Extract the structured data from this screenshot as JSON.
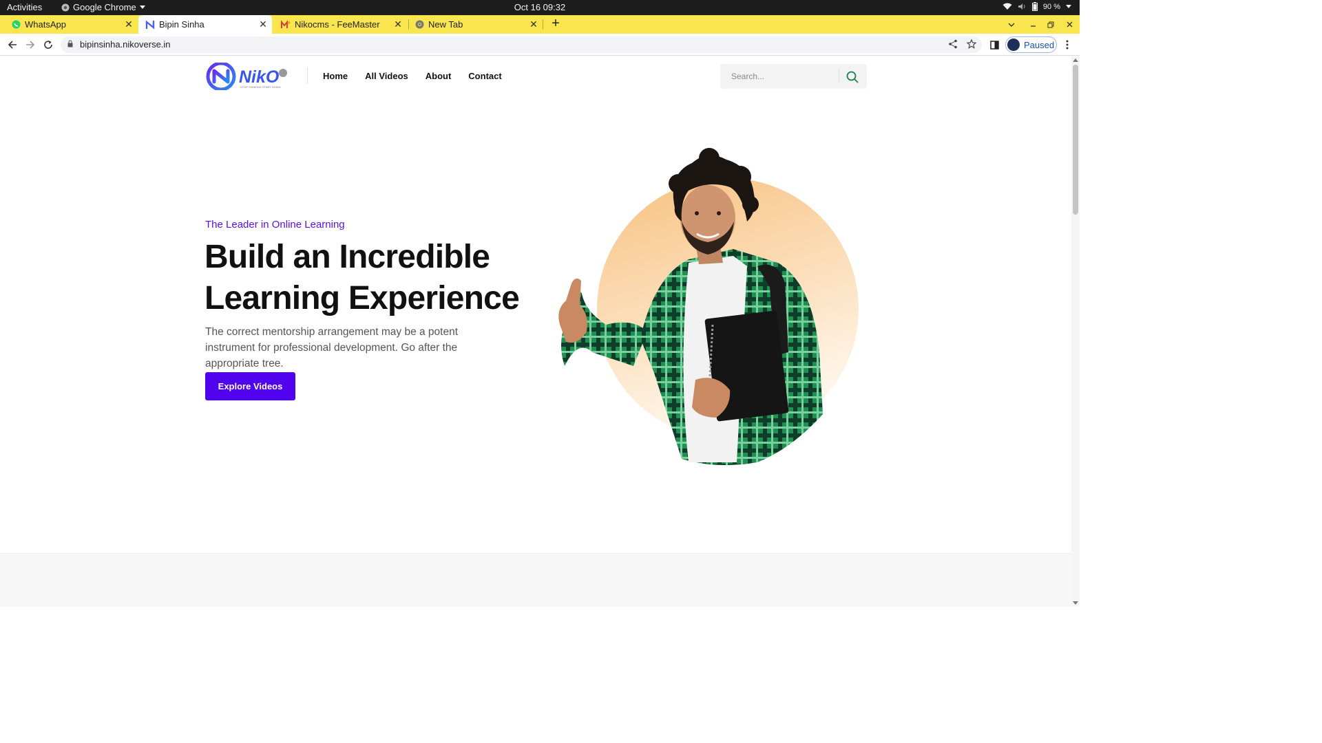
{
  "system": {
    "activities": "Activities",
    "app_name": "Google Chrome",
    "clock": "Oct 16  09:32",
    "battery": "90 %"
  },
  "tabs": [
    {
      "title": "WhatsApp",
      "icon": "whatsapp-icon"
    },
    {
      "title": "Bipin Sinha",
      "icon": "niko-icon",
      "active": true
    },
    {
      "title": "Nikocms - FeeMaster",
      "icon": "feemaster-icon"
    },
    {
      "title": "New Tab",
      "icon": "chrome-icon"
    }
  ],
  "toolbar": {
    "url": "bipinsinha.nikoverse.in",
    "profile_status": "Paused"
  },
  "site": {
    "nav": [
      "Home",
      "All Videos",
      "About",
      "Contact"
    ],
    "search_placeholder": "Search...",
    "logo_text": "NikO",
    "logo_tagline": "STOP THINKING START DOING"
  },
  "hero": {
    "eyebrow": "The Leader in Online Learning",
    "headline_line1": "Build an Incredible",
    "headline_line2": "Learning Experience",
    "subtext": "The correct mentorship arrangement may be a potent instrument for professional development. Go after the appropriate tree.",
    "cta": "Explore Videos"
  },
  "colors": {
    "tabstrip": "#f9e64f",
    "brand_purple": "#5003ec",
    "eyebrow_purple": "#5b0fe8",
    "search_icon": "#1a7f4b",
    "hero_circle": "#f8c98a"
  }
}
